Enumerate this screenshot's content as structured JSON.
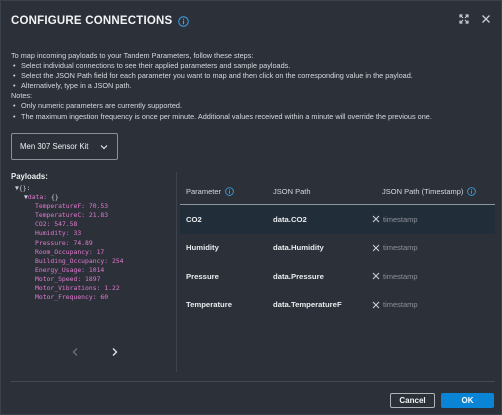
{
  "dialog": {
    "title": "CONFIGURE CONNECTIONS"
  },
  "instructions": {
    "intro": "To map incoming payloads to your Tandem Parameters, follow these steps:",
    "steps": [
      "Select individual connections to see their applied parameters and sample payloads.",
      "Select the JSON Path field for each parameter you want to map and then click on the corresponding value in the payload.",
      "Alternatively, type in a JSON path."
    ],
    "notes_label": "Notes:",
    "notes": [
      "Only numeric parameters are currently supported.",
      "The maximum ingestion frequency is once per minute. Additional values received within a minute will override the previous one."
    ]
  },
  "connection_select": {
    "selected": "Men 307 Sensor Kit"
  },
  "payloads": {
    "label": "Payloads:",
    "root_label": "{}:",
    "data_key": "data:",
    "data_brace": "{}",
    "fields": [
      {
        "key": "TemperatureF:",
        "value": "70.53"
      },
      {
        "key": "TemperatureC:",
        "value": "21.83"
      },
      {
        "key": "CO2:",
        "value": "547.58"
      },
      {
        "key": "Humidity:",
        "value": "33"
      },
      {
        "key": "Pressure:",
        "value": "74.89"
      },
      {
        "key": "Room_Occupancy:",
        "value": "17"
      },
      {
        "key": "Building_Occupancy:",
        "value": "254"
      },
      {
        "key": "Energy_Usage:",
        "value": "1014"
      },
      {
        "key": "Motor_Speed:",
        "value": "1897"
      },
      {
        "key": "Motor_Vibrations:",
        "value": "1.22"
      },
      {
        "key": "Motor_Frequency:",
        "value": "60"
      }
    ]
  },
  "table": {
    "headers": {
      "parameter": "Parameter",
      "json_path": "JSON Path",
      "json_path_ts": "JSON Path (Timestamp)"
    },
    "rows": [
      {
        "parameter": "CO2",
        "json_path": "data.CO2",
        "timestamp_placeholder": "timestamp"
      },
      {
        "parameter": "Humidity",
        "json_path": "data.Humidity",
        "timestamp_placeholder": "timestamp"
      },
      {
        "parameter": "Pressure",
        "json_path": "data.Pressure",
        "timestamp_placeholder": "timestamp"
      },
      {
        "parameter": "Temperature",
        "json_path": "data.TemperatureF",
        "timestamp_placeholder": "timestamp"
      }
    ]
  },
  "buttons": {
    "cancel": "Cancel",
    "ok": "OK"
  },
  "colors": {
    "background": "#2c3139",
    "selected_row": "#222d3a",
    "accent": "#0a84d4",
    "json_value": "#e079d0",
    "info_icon": "#3ea6f0"
  },
  "icons": {
    "title_info": "info-icon",
    "expand": "expand-icon",
    "close": "close-icon",
    "dropdown": "chevron-down-icon",
    "prev": "chevron-left-icon",
    "next": "chevron-right-icon",
    "clear": "clear-x-icon"
  }
}
